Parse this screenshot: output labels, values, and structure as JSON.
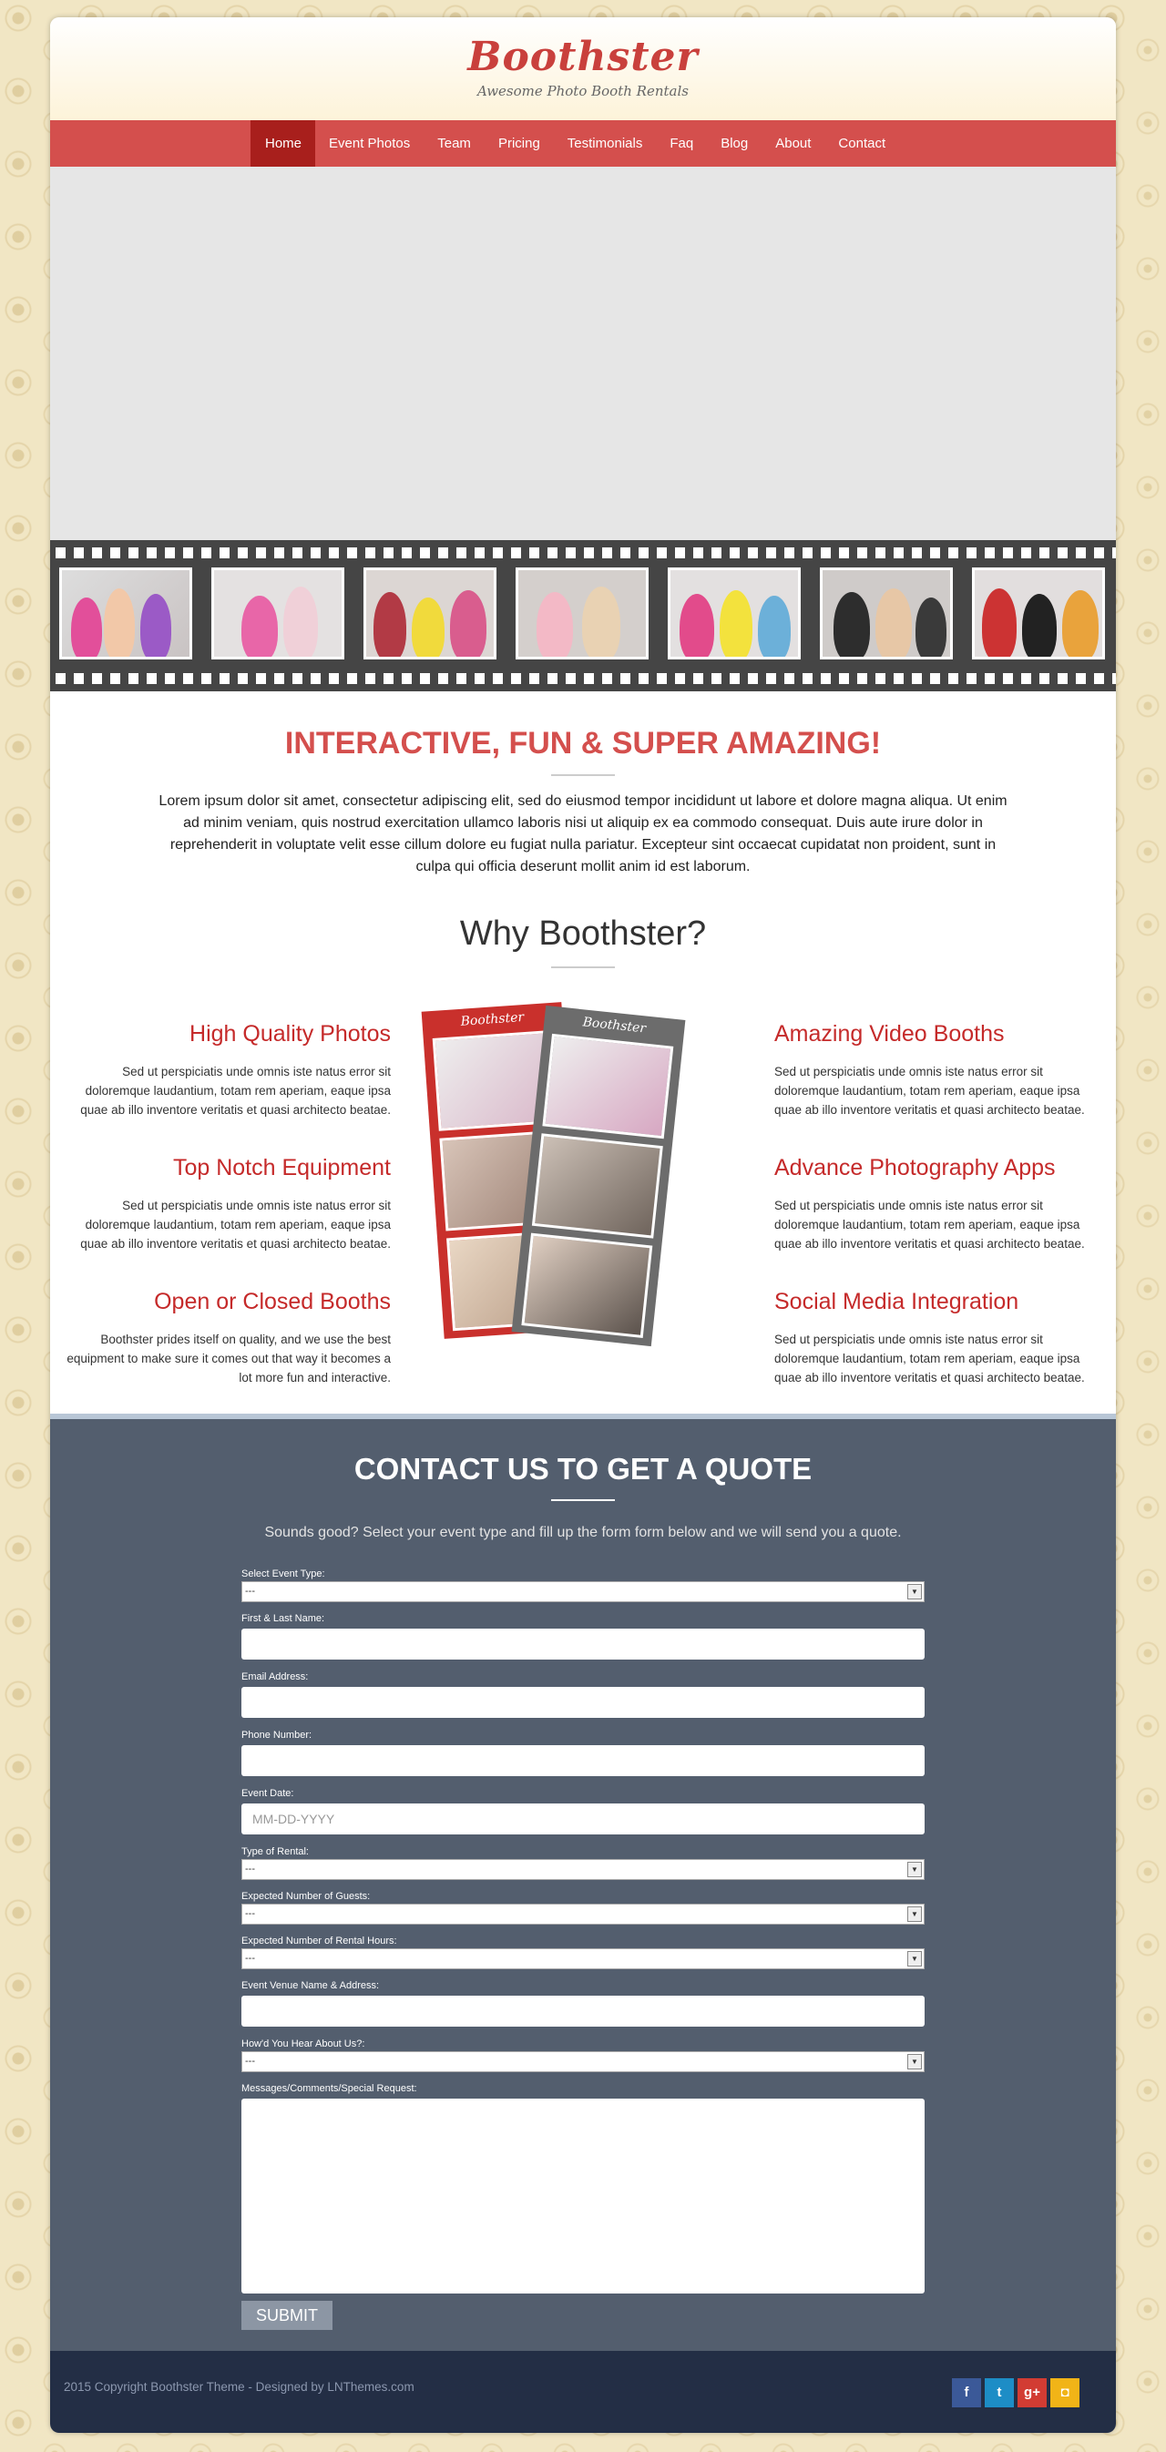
{
  "header": {
    "logo": "Boothster",
    "tagline": "Awesome Photo Booth Rentals"
  },
  "nav": {
    "items": [
      "Home",
      "Event Photos",
      "Team",
      "Pricing",
      "Testimonials",
      "Faq",
      "Blog",
      "About",
      "Contact"
    ],
    "active": "Home"
  },
  "intro": {
    "title": "INTERACTIVE, FUN & SUPER AMAZING!",
    "body": "Lorem ipsum dolor sit amet, consectetur adipiscing elit, sed do eiusmod tempor incididunt ut labore et dolore magna aliqua. Ut enim ad minim veniam, quis nostrud exercitation ullamco laboris nisi ut aliquip ex ea commodo consequat. Duis aute irure dolor in reprehenderit in voluptate velit esse cillum dolore eu fugiat nulla pariatur. Excepteur sint occaecat cupidatat non proident, sunt in culpa qui officia deserunt mollit anim id est laborum."
  },
  "why": {
    "title": "Why Boothster?",
    "strip_brand": "Boothster",
    "features": [
      {
        "title": "High Quality Photos",
        "text": "Sed ut perspiciatis unde omnis iste natus error sit doloremque laudantium, totam rem aperiam, eaque ipsa quae ab illo inventore veritatis et quasi architecto beatae."
      },
      {
        "title": "Top Notch Equipment",
        "text": "Sed ut perspiciatis unde omnis iste natus error sit doloremque laudantium, totam rem aperiam, eaque ipsa quae ab illo inventore veritatis et quasi architecto beatae."
      },
      {
        "title": "Open or Closed Booths",
        "text": "Boothster prides itself on quality, and we use the best equipment to make sure it comes out that way it becomes a lot more fun and interactive."
      },
      {
        "title": "Amazing Video Booths",
        "text": "Sed ut perspiciatis unde omnis iste natus error sit doloremque laudantium, totam rem aperiam, eaque ipsa quae ab illo inventore veritatis et quasi architecto beatae."
      },
      {
        "title": "Advance Photography Apps",
        "text": "Sed ut perspiciatis unde omnis iste natus error sit doloremque laudantium, totam rem aperiam, eaque ipsa quae ab illo inventore veritatis et quasi architecto beatae."
      },
      {
        "title": "Social Media Integration",
        "text": "Sed ut perspiciatis unde omnis iste natus error sit doloremque laudantium, totam rem aperiam, eaque ipsa quae ab illo inventore veritatis et quasi architecto beatae."
      }
    ]
  },
  "contact": {
    "title": "CONTACT US TO GET A QUOTE",
    "lead": "Sounds good? Select your event type and fill up the form form below and we will send you a quote.",
    "fields": {
      "event_type": {
        "label": "Select Event Type:",
        "value": "---"
      },
      "name": {
        "label": "First & Last Name:"
      },
      "email": {
        "label": "Email Address:"
      },
      "phone": {
        "label": "Phone Number:"
      },
      "date": {
        "label": "Event Date:",
        "placeholder": "MM-DD-YYYY"
      },
      "rental_type": {
        "label": "Type of Rental:",
        "value": "---"
      },
      "guests": {
        "label": "Expected Number of Guests:",
        "value": "---"
      },
      "hours": {
        "label": "Expected Number of Rental Hours:",
        "value": "---"
      },
      "venue": {
        "label": "Event Venue Name & Address:"
      },
      "hear": {
        "label": "How'd You Hear About Us?:",
        "value": "---"
      },
      "message": {
        "label": "Messages/Comments/Special Request:"
      }
    },
    "submit": "SUBMIT"
  },
  "footer": {
    "copyright": "2015 Copyright Boothster Theme - Designed by LNThemes.com",
    "social": [
      {
        "icon": "facebook-icon",
        "glyph": "f",
        "color": "#3b5998"
      },
      {
        "icon": "twitter-icon",
        "glyph": "t",
        "color": "#1d8dc6"
      },
      {
        "icon": "google-plus-icon",
        "glyph": "g+",
        "color": "#d23c33"
      },
      {
        "icon": "instagram-icon",
        "glyph": "◘",
        "color": "#f1b417"
      }
    ]
  },
  "colors": {
    "accent": "#d44f4d",
    "nav_active": "#a81f1c",
    "contact_bg": "#535e6e",
    "footer_bg": "#232e45"
  }
}
